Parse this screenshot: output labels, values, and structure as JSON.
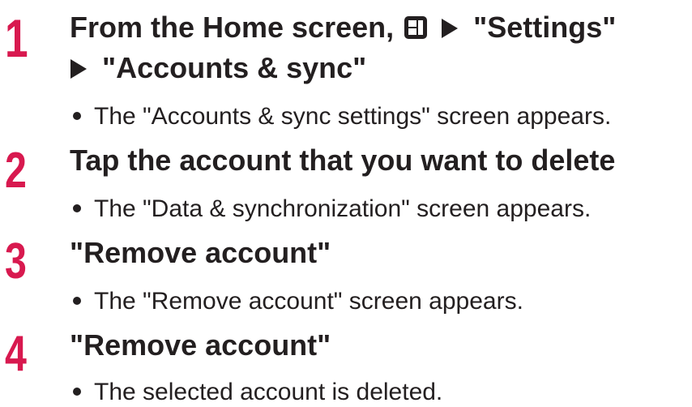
{
  "steps": [
    {
      "number": "1",
      "title_part1": "From the Home screen,",
      "title_part2": "\"Settings\"",
      "title_line2": "\"Accounts & sync\"",
      "note": "The \"Accounts & sync settings\" screen appears."
    },
    {
      "number": "2",
      "title": "Tap the account that you want to delete",
      "note": "The \"Data & synchronization\" screen appears."
    },
    {
      "number": "3",
      "title": "\"Remove account\"",
      "note": "The \"Remove account\" screen appears."
    },
    {
      "number": "4",
      "title": "\"Remove account\"",
      "note": "The selected account is deleted."
    }
  ],
  "icons": {
    "menu": "menu-key-icon",
    "arrow": "right-triangle-arrow-icon"
  },
  "colors": {
    "step_number": "#d8194f",
    "text": "#231f20"
  }
}
